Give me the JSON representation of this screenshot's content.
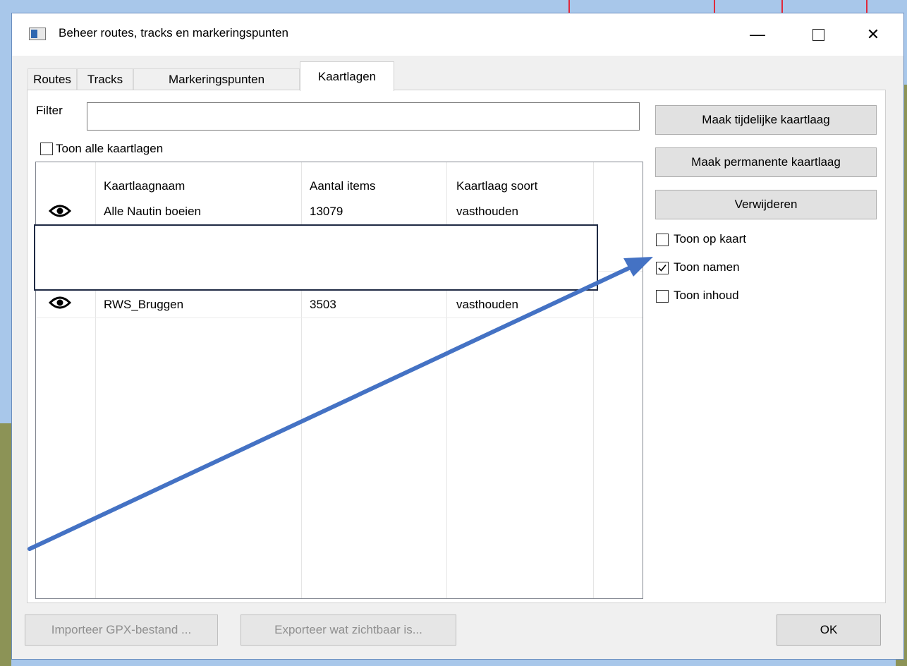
{
  "window": {
    "title": "Beheer routes, tracks en markeringspunten"
  },
  "tabs": [
    {
      "label": "Routes"
    },
    {
      "label": "Tracks"
    },
    {
      "label": "Markeringspunten"
    },
    {
      "label": "Kaartlagen"
    }
  ],
  "filter": {
    "label": "Filter",
    "value": ""
  },
  "show_all": {
    "label": "Toon alle kaartlagen",
    "checked": false
  },
  "table": {
    "headers": [
      "Kaartlaagnaam",
      "Aantal items",
      "Kaartlaag soort"
    ],
    "rows": [
      {
        "icon": "eye-icon",
        "name": "Alle Nautin boeien",
        "count": "13079",
        "type": "vasthouden"
      },
      {
        "icon": "eye-icon",
        "name": "RWS_Bruggen",
        "count": "3503",
        "type": "vasthouden"
      }
    ]
  },
  "actions": {
    "temp_layer": "Maak tijdelijke kaartlaag",
    "perm_layer": "Maak permanente kaartlaag",
    "delete": "Verwijderen"
  },
  "options": [
    {
      "label": "Toon op kaart",
      "checked": false
    },
    {
      "label": "Toon namen",
      "checked": true
    },
    {
      "label": "Toon inhoud",
      "checked": false
    }
  ],
  "footer": {
    "import": "Importeer GPX-bestand ...",
    "export": "Exporteer wat zichtbaar is...",
    "ok": "OK"
  },
  "colors": {
    "annotation_arrow": "#4472c4",
    "highlight_border": "#1f2a44"
  }
}
